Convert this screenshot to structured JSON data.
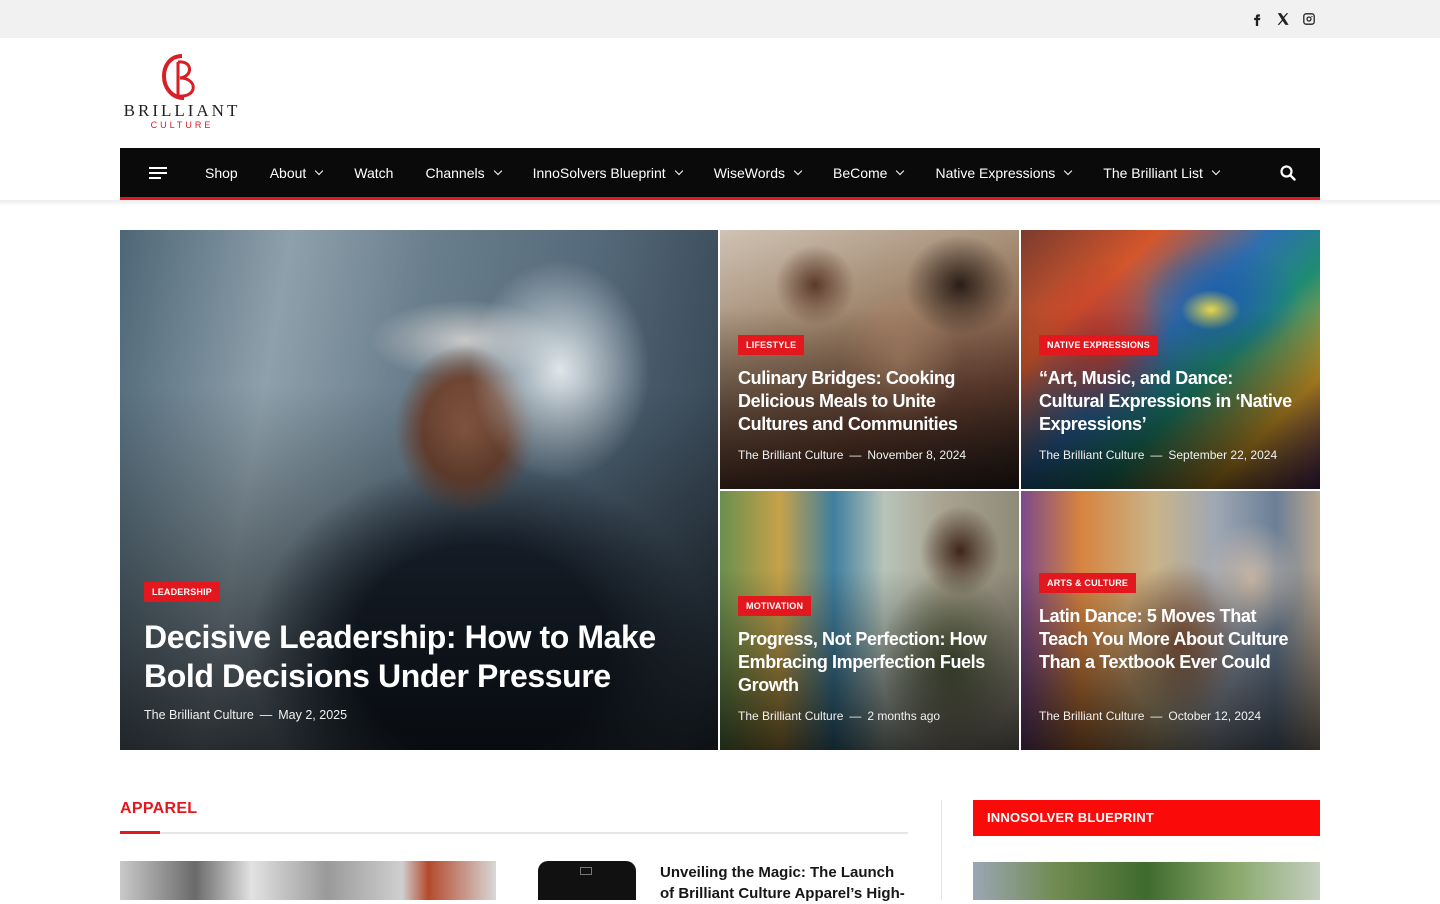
{
  "social": {
    "icons": [
      "facebook-icon",
      "x-icon",
      "instagram-icon"
    ]
  },
  "logo": {
    "word1": "BRILLIANT",
    "word2": "CULTURE",
    "accent": "#d81f26"
  },
  "nav": {
    "items": [
      {
        "label": "Shop",
        "dropdown": false
      },
      {
        "label": "About",
        "dropdown": true
      },
      {
        "label": "Watch",
        "dropdown": false
      },
      {
        "label": "Channels",
        "dropdown": true
      },
      {
        "label": "InnoSolvers Blueprint",
        "dropdown": true
      },
      {
        "label": "WiseWords",
        "dropdown": true
      },
      {
        "label": "BeCome",
        "dropdown": true
      },
      {
        "label": "Native Expressions",
        "dropdown": true
      },
      {
        "label": "The Brilliant List",
        "dropdown": true
      }
    ],
    "accent": "#e3171e"
  },
  "hero": {
    "main": {
      "category": "LEADERSHIP",
      "title": "Decisive Leadership: How to Make Bold Decisions Under Pressure",
      "author": "The Brilliant Culture",
      "date": "May 2, 2025"
    },
    "cards": [
      {
        "category": "LIFESTYLE",
        "title": "Culinary Bridges: Cooking Delicious Meals to Unite Cultures and Communities",
        "author": "The Brilliant Culture",
        "date": "November 8, 2024"
      },
      {
        "category": "NATIVE EXPRESSIONS",
        "title": "“Art, Music, and Dance: Cultural Expressions in ‘Native Expressions’",
        "author": "The Brilliant Culture",
        "date": "September 22, 2024"
      },
      {
        "category": "MOTIVATION",
        "title": "Progress, Not Perfection: How Embracing Imperfection Fuels Growth",
        "author": "The Brilliant Culture",
        "date": "2 months ago"
      },
      {
        "category": "ARTS & CULTURE",
        "title": "Latin Dance: 5 Moves That Teach You More About Culture Than a Textbook Ever Could",
        "author": "The Brilliant Culture",
        "date": "October 12, 2024"
      }
    ]
  },
  "sections": {
    "apparel": {
      "heading": "APPAREL",
      "article_title": "Unveiling the Magic: The Launch of Brilliant Culture Apparel’s High-"
    },
    "sidebar": {
      "heading": "INNOSOLVER BLUEPRINT"
    }
  }
}
